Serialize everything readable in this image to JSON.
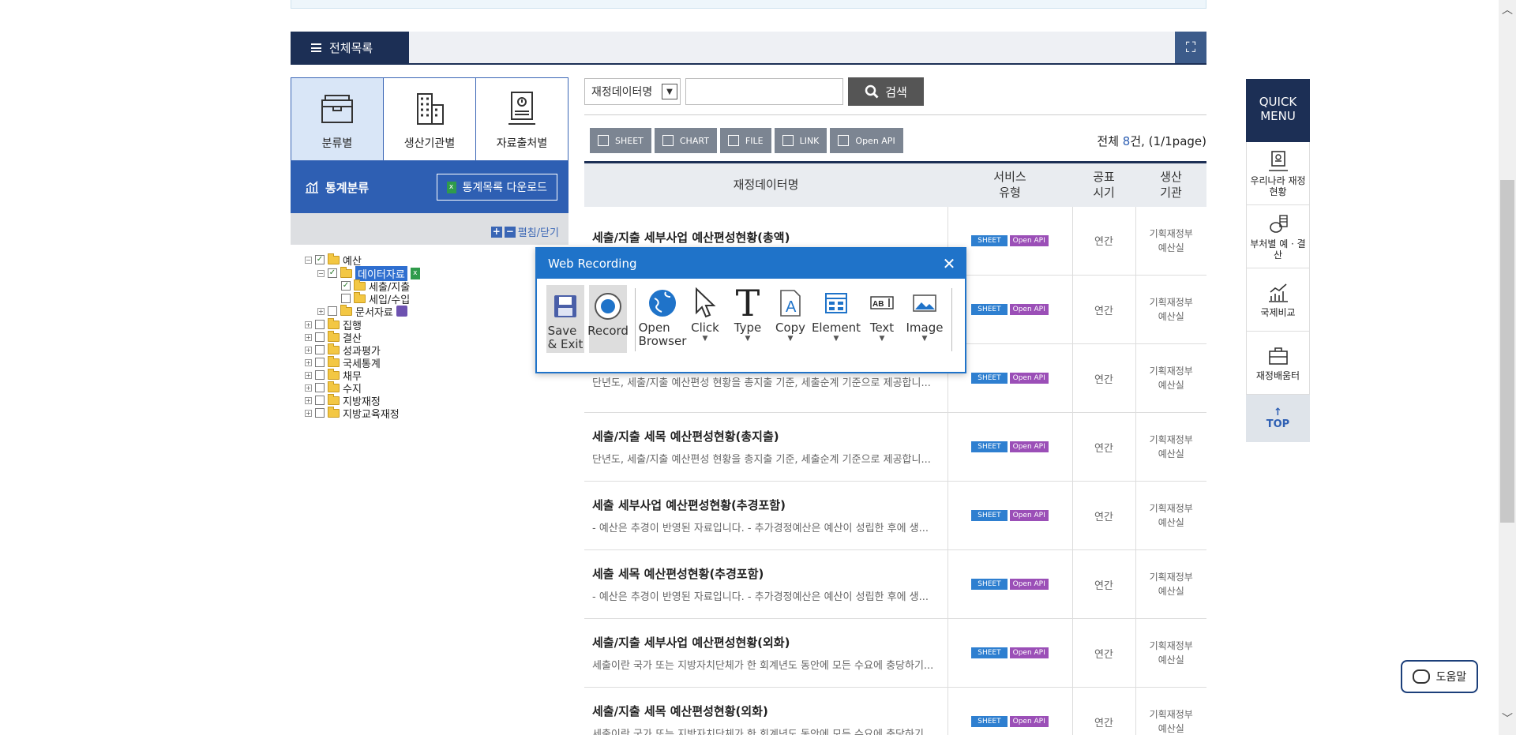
{
  "header": {
    "title": "전체목록"
  },
  "left": {
    "tabs": [
      {
        "label": "분류별",
        "active": true
      },
      {
        "label": "생산기관별",
        "active": false
      },
      {
        "label": "자료출처별",
        "active": false
      }
    ],
    "stat_label": "통계분류",
    "download_label": "통계목록 다운로드",
    "toggle_label": "펼침/닫기",
    "tree": [
      {
        "label": "예산",
        "checked": true
      },
      {
        "label": "데이터자료",
        "checked": true,
        "selected": true
      },
      {
        "label": "세출/지출",
        "checked": true
      },
      {
        "label": "세입/수입",
        "checked": false
      },
      {
        "label": "문서자료",
        "checked": false
      },
      {
        "label": "집행",
        "checked": false
      },
      {
        "label": "결산",
        "checked": false
      },
      {
        "label": "성과평가",
        "checked": false
      },
      {
        "label": "국세통계",
        "checked": false
      },
      {
        "label": "채무",
        "checked": false
      },
      {
        "label": "수지",
        "checked": false
      },
      {
        "label": "지방재정",
        "checked": false
      },
      {
        "label": "지방교육재정",
        "checked": false
      }
    ]
  },
  "search": {
    "select_value": "재정데이터명",
    "button": "검색"
  },
  "tools": [
    "SHEET",
    "CHART",
    "FILE",
    "LINK",
    "Open API"
  ],
  "total": {
    "prefix": "전체 ",
    "count": "8",
    "suffix": "건, (1/1page)"
  },
  "table": {
    "headers": [
      "재정데이터명",
      "서비스\n유형",
      "공표\n시기",
      "생산\n기관"
    ],
    "badges": {
      "sheet": "SHEET",
      "api": "Open API"
    },
    "rows": [
      {
        "title": "세출/지출 세부사업 예산편성현황(총액)",
        "desc": "",
        "period": "연간",
        "org1": "기획재정부",
        "org2": "예산실"
      },
      {
        "title": "",
        "desc": "",
        "period": "연간",
        "org1": "기획재정부",
        "org2": "예산실"
      },
      {
        "title": "",
        "desc": "단년도, 세출/지출 예산편성 현황을 총지출 기준, 세출순계 기준으로 제공합니...",
        "period": "연간",
        "org1": "기획재정부",
        "org2": "예산실"
      },
      {
        "title": "세출/지출 세목 예산편성현황(총지출)",
        "desc": "단년도, 세출/지출 예산편성 현황을 총지출 기준, 세출순계 기준으로 제공합니...",
        "period": "연간",
        "org1": "기획재정부",
        "org2": "예산실"
      },
      {
        "title": "세출 세부사업 예산편성현황(추경포함)",
        "desc": "- 예산은 추경이 반영된 자료입니다. - 추가경정예산은 예산이 성립한 후에 생...",
        "period": "연간",
        "org1": "기획재정부",
        "org2": "예산실"
      },
      {
        "title": "세출 세목 예산편성현황(추경포함)",
        "desc": "- 예산은 추경이 반영된 자료입니다. - 추가경정예산은 예산이 성립한 후에 생...",
        "period": "연간",
        "org1": "기획재정부",
        "org2": "예산실"
      },
      {
        "title": "세출/지출 세부사업 예산편성현황(외화)",
        "desc": "세출이란 국가 또는 지방자치단체가 한 회계년도 동안에 모든 수요에 충당하기...",
        "period": "연간",
        "org1": "기획재정부",
        "org2": "예산실"
      },
      {
        "title": "세출/지출 세목 예산편성현황(외화)",
        "desc": "세출이란 국가 또는 지방자치단체가 한 회계년도 동안에 모든 수요에 충당하기...",
        "period": "연간",
        "org1": "기획재정부",
        "org2": "예산실"
      }
    ]
  },
  "quick": {
    "head": "QUICK MENU",
    "items": [
      "우리나라 재정현황",
      "부처별 예 · 결산",
      "국제비교",
      "재정배움터"
    ],
    "top": "TOP"
  },
  "help": "도움말",
  "recorder": {
    "title": "Web Recording",
    "tools": [
      {
        "label": "Save\n& Exit",
        "icon": "save-icon"
      },
      {
        "label": "Record",
        "icon": "record-icon"
      },
      {
        "label": "Open\nBrowser",
        "icon": "globe-icon"
      },
      {
        "label": "Click",
        "icon": "cursor-icon"
      },
      {
        "label": "Type",
        "icon": "type-icon"
      },
      {
        "label": "Copy",
        "icon": "copy-icon"
      },
      {
        "label": "Element",
        "icon": "element-icon"
      },
      {
        "label": "Text",
        "icon": "text-icon"
      },
      {
        "label": "Image",
        "icon": "image-icon"
      }
    ]
  }
}
